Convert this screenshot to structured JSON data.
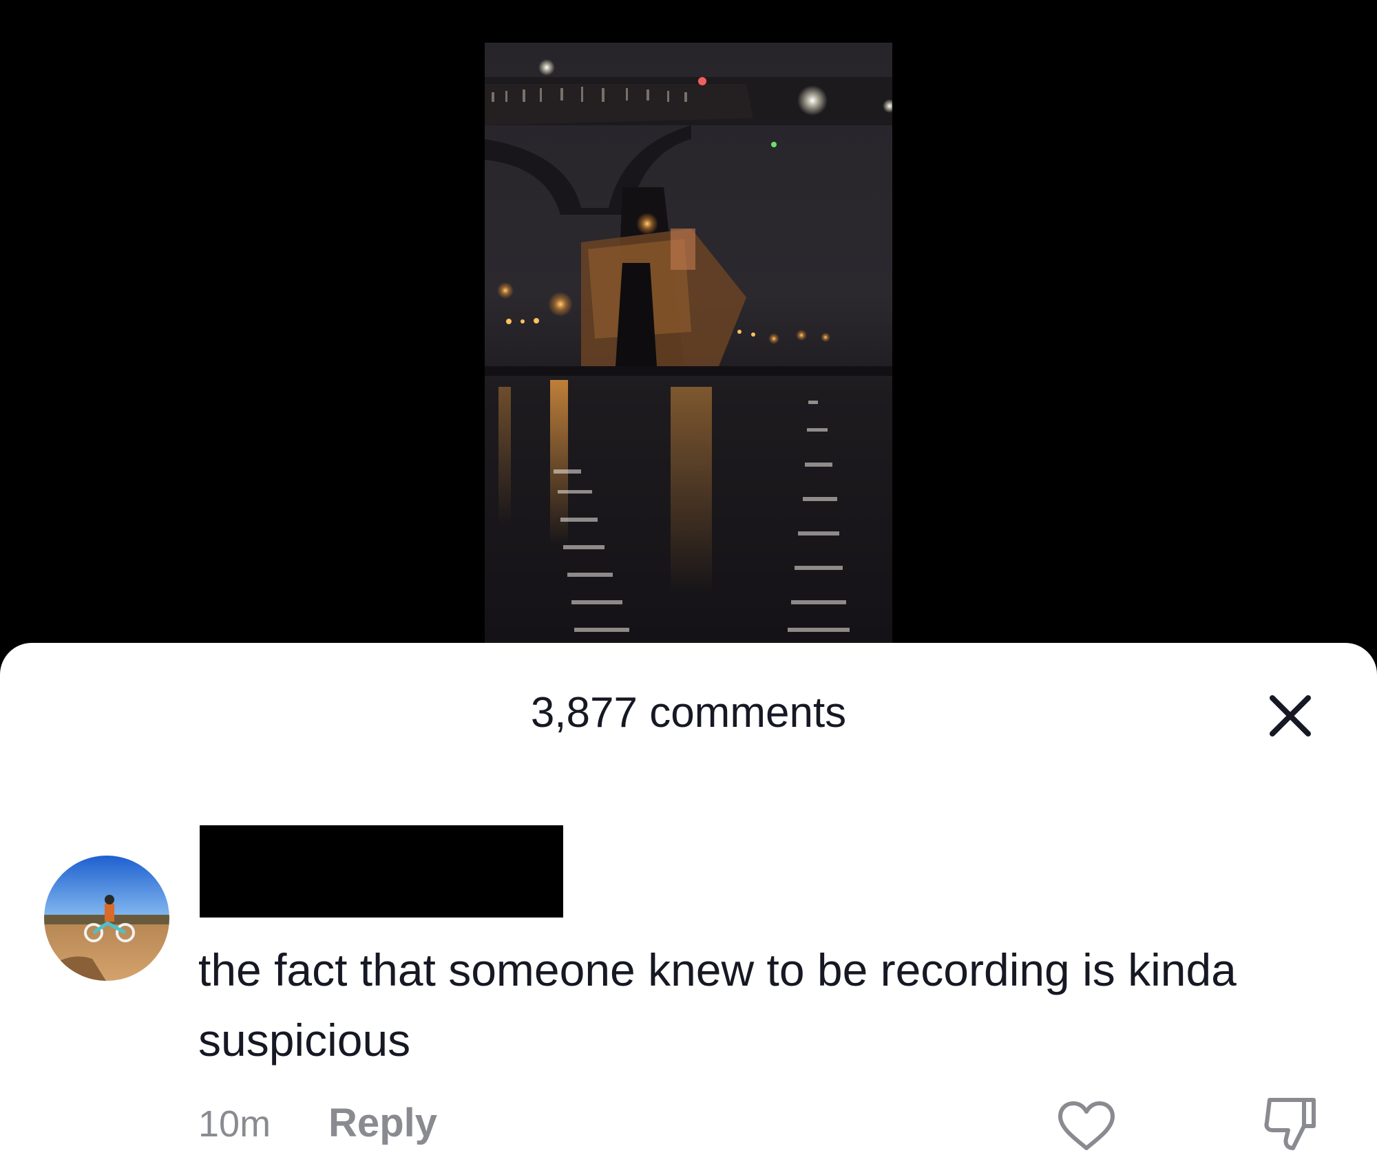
{
  "comments_panel": {
    "count_label": "3,877 comments",
    "close_icon": "close-icon"
  },
  "comment": {
    "avatar_icon": "avatar",
    "username_redacted": true,
    "text": "the fact that someone knew to be recording is kinda suspicious",
    "timestamp": "10m",
    "reply_label": "Reply",
    "like_icon": "heart-icon",
    "dislike_icon": "thumbs-down-icon"
  },
  "colors": {
    "sheet_background": "#ffffff",
    "primary_text": "#161823",
    "secondary_text": "#8a8b91",
    "video_background": "#000000"
  }
}
